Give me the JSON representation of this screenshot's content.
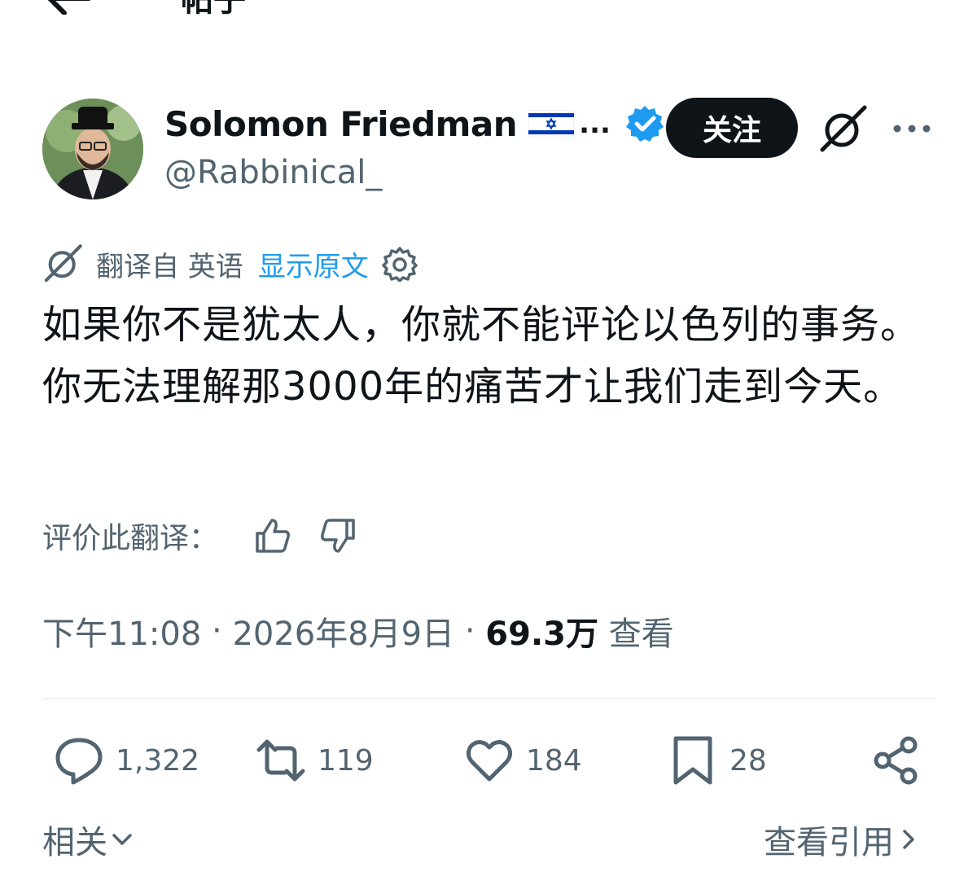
{
  "header": {
    "title": "帖子",
    "back_icon": "arrow-left-icon"
  },
  "author": {
    "display_name": "Solomon Friedman",
    "name_truncation": "...",
    "handle": "@Rabbinical_",
    "flag": "israel-flag-icon",
    "verified_badge": "verified-icon",
    "verified_color": "#1d9bf0"
  },
  "actions_top": {
    "follow_label": "关注",
    "grok_icon": "grok-icon",
    "more_icon": "more-icon"
  },
  "translation": {
    "label": "翻译自 英语",
    "show_original": "显示原文",
    "settings_icon": "gear-icon",
    "link_color": "#1d9bf0"
  },
  "tweet": {
    "text": "如果你不是犹太人，你就不能评论以色列的事务。你无法理解那3000年的痛苦才让我们走到今天。"
  },
  "rating": {
    "label": "评价此翻译："
  },
  "meta": {
    "time": "下午11:08",
    "separator": " · ",
    "date": "2026年8月9日",
    "views": "69.3万",
    "views_label": "查看"
  },
  "engagement": {
    "replies": "1,322",
    "retweets": "119",
    "likes": "184",
    "bookmarks": "28"
  },
  "footer": {
    "related": "相关",
    "view_quotes": "查看引用"
  }
}
